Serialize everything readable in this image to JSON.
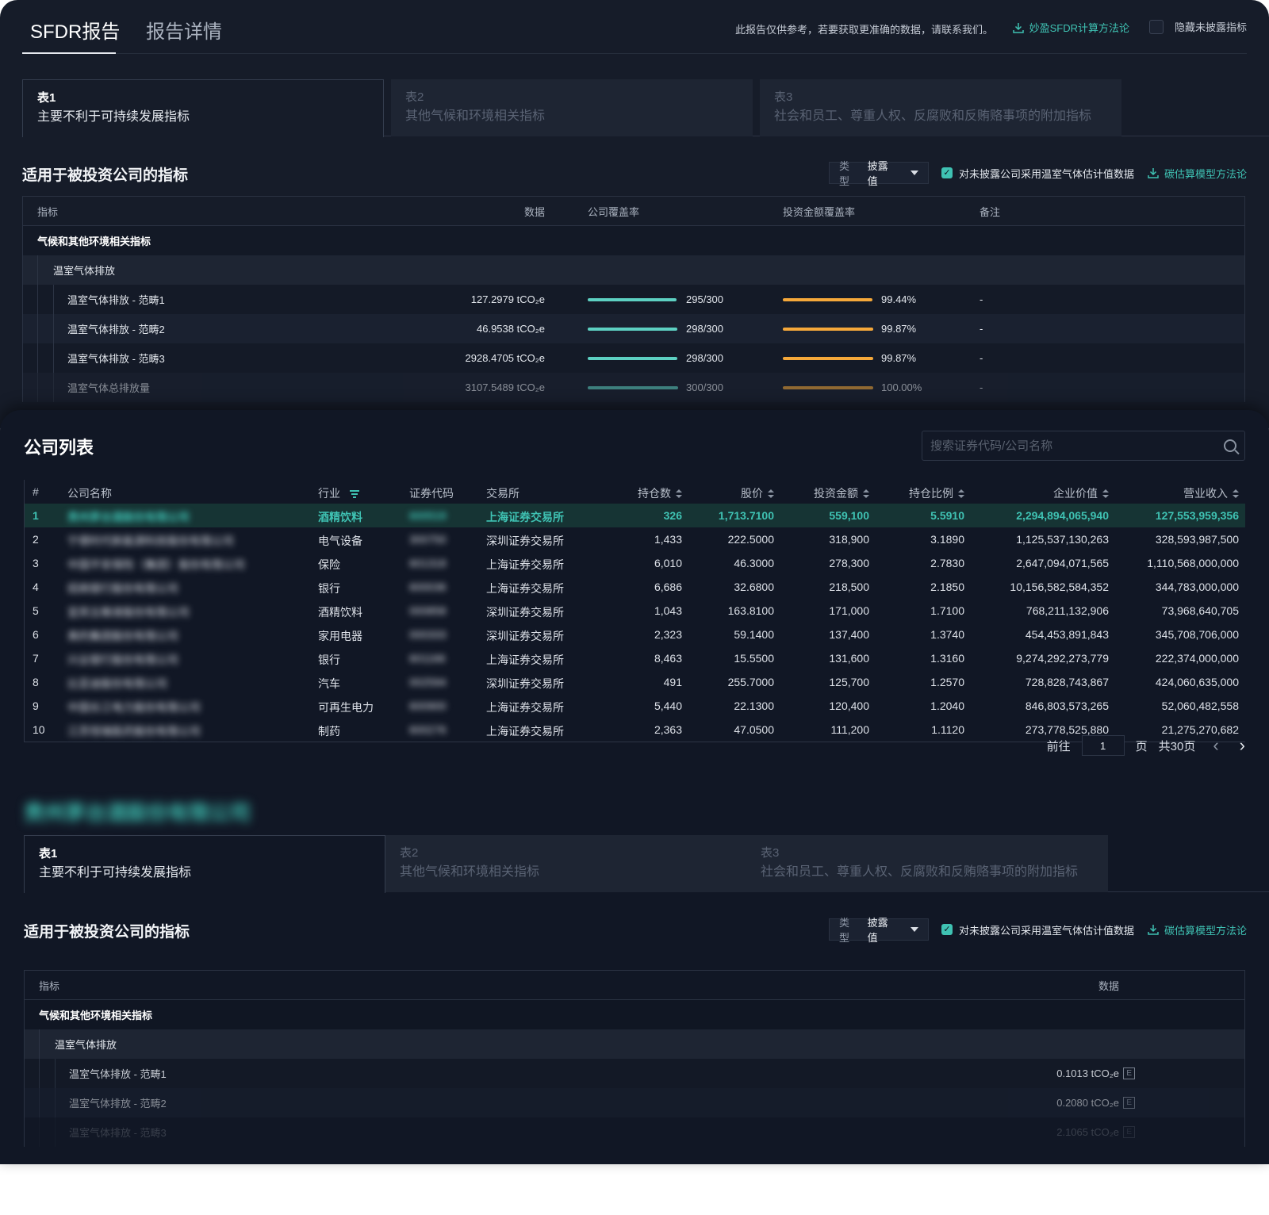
{
  "header": {
    "tabs": [
      "SFDR报告",
      "报告详情"
    ],
    "notice": "此报告仅供参考，若要获取更准确的数据，请联系我们。",
    "methodology_link": "妙盈SFDR计算方法论",
    "hide_label": "隐藏未披露指标"
  },
  "table_tabs": [
    {
      "title": "表1",
      "subtitle": "主要不利于可持续发展指标"
    },
    {
      "title": "表2",
      "subtitle": "其他气候和环境相关指标"
    },
    {
      "title": "表3",
      "subtitle": "社会和员工、尊重人权、反腐败和反贿赂事项的附加指标"
    }
  ],
  "indicators": {
    "section_title": "适用于被投资公司的指标",
    "type_label": "类型",
    "type_value": "披露值",
    "estimate_label": "对未披露公司采用温室气体估计值数据",
    "carbon_link": "碳估算模型方法论",
    "columns": {
      "indicator": "指标",
      "data": "数据",
      "company_coverage": "公司覆盖率",
      "amount_coverage": "投资金额覆盖率",
      "note": "备注"
    },
    "category": "气候和其他环境相关指标",
    "subcategory": "温室气体排放",
    "rows": [
      {
        "name": "温室气体排放 - 范畴1",
        "data": "127.2979 tCO₂e",
        "coverage": "295/300",
        "coverage_frac": 0.983,
        "amount": "99.44%",
        "amount_frac": 0.9944,
        "note": "-"
      },
      {
        "name": "温室气体排放 - 范畴2",
        "data": "46.9538 tCO₂e",
        "coverage": "298/300",
        "coverage_frac": 0.993,
        "amount": "99.87%",
        "amount_frac": 0.9987,
        "note": "-"
      },
      {
        "name": "温室气体排放 - 范畴3",
        "data": "2928.4705 tCO₂e",
        "coverage": "298/300",
        "coverage_frac": 0.993,
        "amount": "99.87%",
        "amount_frac": 0.9987,
        "note": "-"
      },
      {
        "name": "温室气体总排放量",
        "data": "3107.5489 tCO₂e",
        "coverage": "300/300",
        "coverage_frac": 1.0,
        "amount": "100.00%",
        "amount_frac": 1.0,
        "note": "-"
      }
    ]
  },
  "company_list": {
    "title": "公司列表",
    "search_placeholder": "搜索证券代码/公司名称",
    "columns": {
      "idx": "#",
      "name": "公司名称",
      "industry": "行业",
      "code": "证券代码",
      "exchange": "交易所",
      "shares": "持仓数",
      "price": "股价",
      "amount": "投资金额",
      "weight": "持仓比例",
      "ev": "企业价值",
      "revenue": "营业收入"
    },
    "rows": [
      {
        "idx": "1",
        "name": "贵州茅台酒股份有限公司",
        "industry": "酒精饮料",
        "code": "600519",
        "exchange": "上海证券交易所",
        "shares": "326",
        "price": "1,713.7100",
        "amount": "559,100",
        "weight": "5.5910",
        "ev": "2,294,894,065,940",
        "revenue": "127,553,959,356"
      },
      {
        "idx": "2",
        "name": "宁德时代新能源科技股份有限公司",
        "industry": "电气设备",
        "code": "300750",
        "exchange": "深圳证券交易所",
        "shares": "1,433",
        "price": "222.5000",
        "amount": "318,900",
        "weight": "3.1890",
        "ev": "1,125,537,130,263",
        "revenue": "328,593,987,500"
      },
      {
        "idx": "3",
        "name": "中国平安保险（集团）股份有限公司",
        "industry": "保险",
        "code": "601318",
        "exchange": "上海证券交易所",
        "shares": "6,010",
        "price": "46.3000",
        "amount": "278,300",
        "weight": "2.7830",
        "ev": "2,647,094,071,565",
        "revenue": "1,110,568,000,000"
      },
      {
        "idx": "4",
        "name": "招商银行股份有限公司",
        "industry": "银行",
        "code": "600036",
        "exchange": "上海证券交易所",
        "shares": "6,686",
        "price": "32.6800",
        "amount": "218,500",
        "weight": "2.1850",
        "ev": "10,156,582,584,352",
        "revenue": "344,783,000,000"
      },
      {
        "idx": "5",
        "name": "宜宾五粮液股份有限公司",
        "industry": "酒精饮料",
        "code": "000858",
        "exchange": "深圳证券交易所",
        "shares": "1,043",
        "price": "163.8100",
        "amount": "171,000",
        "weight": "1.7100",
        "ev": "768,211,132,906",
        "revenue": "73,968,640,705"
      },
      {
        "idx": "6",
        "name": "美的集团股份有限公司",
        "industry": "家用电器",
        "code": "000333",
        "exchange": "深圳证券交易所",
        "shares": "2,323",
        "price": "59.1400",
        "amount": "137,400",
        "weight": "1.3740",
        "ev": "454,453,891,843",
        "revenue": "345,708,706,000"
      },
      {
        "idx": "7",
        "name": "兴业银行股份有限公司",
        "industry": "银行",
        "code": "601166",
        "exchange": "上海证券交易所",
        "shares": "8,463",
        "price": "15.5500",
        "amount": "131,600",
        "weight": "1.3160",
        "ev": "9,274,292,273,779",
        "revenue": "222,374,000,000"
      },
      {
        "idx": "8",
        "name": "比亚迪股份有限公司",
        "industry": "汽车",
        "code": "002594",
        "exchange": "深圳证券交易所",
        "shares": "491",
        "price": "255.7000",
        "amount": "125,700",
        "weight": "1.2570",
        "ev": "728,828,743,867",
        "revenue": "424,060,635,000"
      },
      {
        "idx": "9",
        "name": "中国长江电力股份有限公司",
        "industry": "可再生电力",
        "code": "600900",
        "exchange": "上海证券交易所",
        "shares": "5,440",
        "price": "22.1300",
        "amount": "120,400",
        "weight": "1.2040",
        "ev": "846,803,573,265",
        "revenue": "52,060,482,558"
      },
      {
        "idx": "10",
        "name": "江苏恒瑞医药股份有限公司",
        "industry": "制药",
        "code": "600276",
        "exchange": "上海证券交易所",
        "shares": "2,363",
        "price": "47.0500",
        "amount": "111,200",
        "weight": "1.1120",
        "ev": "273,778,525,880",
        "revenue": "21,275,270,682"
      }
    ],
    "pager": {
      "goto": "前往",
      "page": "1",
      "page_unit": "页",
      "total": "共30页"
    }
  },
  "company_detail": {
    "name": "贵州茅台酒股份有限公司",
    "section_title": "适用于被投资公司的指标",
    "type_label": "类型",
    "type_value": "披露值",
    "estimate_label": "对未披露公司采用温室气体估计值数据",
    "carbon_link": "碳估算模型方法论",
    "columns": {
      "indicator": "指标",
      "data": "数据"
    },
    "category": "气候和其他环境相关指标",
    "subcategory": "温室气体排放",
    "rows": [
      {
        "name": "温室气体排放 - 范畴1",
        "data": "0.1013 tCO₂e",
        "badge": "E"
      },
      {
        "name": "温室气体排放 - 范畴2",
        "data": "0.2080 tCO₂e",
        "badge": "E"
      },
      {
        "name": "温室气体排放 - 范畴3",
        "data": "2.1065 tCO₂e",
        "badge": "E"
      }
    ]
  },
  "colors": {
    "accent": "#3fc2b3",
    "orange": "#f5a83a",
    "background": "#161c29"
  },
  "icons": {
    "download": "download-icon",
    "search": "search-icon",
    "sort": "sort-icon",
    "filter": "filter-icon",
    "prev": "chevron-left-icon",
    "next": "chevron-right-icon"
  }
}
